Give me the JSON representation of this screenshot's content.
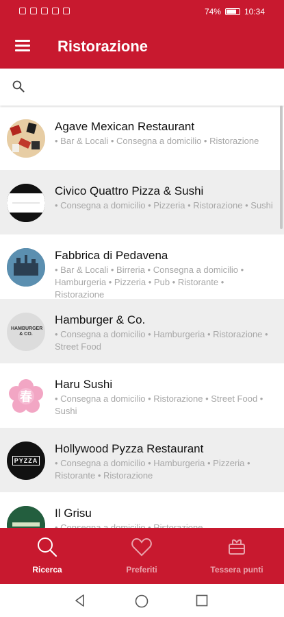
{
  "status_bar": {
    "battery_text": "74%",
    "time": "10:34"
  },
  "app_bar": {
    "title": "Ristorazione"
  },
  "search": {
    "placeholder": ""
  },
  "restaurants": [
    {
      "name": "Agave Mexican Restaurant",
      "categories": "• Bar & Locali • Consegna a domicilio • Ristorazione"
    },
    {
      "name": "Civico Quattro Pizza & Sushi",
      "categories": "• Consegna a domicilio • Pizzeria • Ristorazione • Sushi"
    },
    {
      "name": "Fabbrica di Pedavena",
      "categories": "• Bar & Locali • Birreria • Consegna a domicilio • Hamburgeria • Pizzeria • Pub • Ristorante • Ristorazione"
    },
    {
      "name": "Hamburger & Co.",
      "categories": "• Consegna a domicilio • Hamburgeria • Ristorazione • Street Food"
    },
    {
      "name": "Haru Sushi",
      "categories": "• Consegna a domicilio • Ristorazione • Street Food • Sushi"
    },
    {
      "name": "Hollywood Pyzza Restaurant",
      "categories": "• Consegna a domicilio • Hamburgeria • Pizzeria • Ristorante • Ristorazione"
    },
    {
      "name": "Il Grisu",
      "categories": "• Consegna a domicilio • Ristorazione"
    }
  ],
  "avatar_text": {
    "hamburger": "HAMBURGER & CO.",
    "haru": "春",
    "hollywood": "PYZZA"
  },
  "tabs": [
    {
      "label": "Ricerca",
      "icon": "search-icon"
    },
    {
      "label": "Preferiti",
      "icon": "heart-icon"
    },
    {
      "label": "Tessera punti",
      "icon": "card-icon"
    }
  ],
  "colors": {
    "primary": "#c8192f",
    "alt_row": "#eeeeee",
    "muted_text": "#a7a7a7"
  }
}
